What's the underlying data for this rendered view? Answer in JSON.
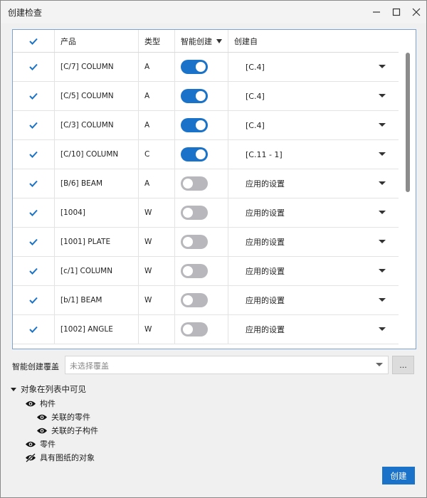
{
  "window": {
    "title": "创建检查"
  },
  "colors": {
    "accent": "#1a73c8",
    "toggle_off": "#b8b8bc",
    "frame_border": "#7da2ce"
  },
  "table": {
    "headers": {
      "product": "产品",
      "type": "类型",
      "smart_create": "智能创建",
      "created_from": "创建自"
    },
    "rows": [
      {
        "product": "[C/7] COLUMN",
        "type": "A",
        "smart": true,
        "source": "[C.4]",
        "checked": true
      },
      {
        "product": "[C/5] COLUMN",
        "type": "A",
        "smart": true,
        "source": "[C.4]",
        "checked": true
      },
      {
        "product": "[C/3] COLUMN",
        "type": "A",
        "smart": true,
        "source": "[C.4]",
        "checked": true
      },
      {
        "product": "[C/10] COLUMN",
        "type": "C",
        "smart": true,
        "source": "[C.11 - 1]",
        "checked": true
      },
      {
        "product": "[B/6] BEAM",
        "type": "A",
        "smart": false,
        "source": "应用的设置",
        "checked": true
      },
      {
        "product": "[1004]",
        "type": "W",
        "smart": false,
        "source": "应用的设置",
        "checked": true
      },
      {
        "product": "[1001] PLATE",
        "type": "W",
        "smart": false,
        "source": "应用的设置",
        "checked": true
      },
      {
        "product": "[c/1] COLUMN",
        "type": "W",
        "smart": false,
        "source": "应用的设置",
        "checked": true
      },
      {
        "product": "[b/1] BEAM",
        "type": "W",
        "smart": false,
        "source": "应用的设置",
        "checked": true
      },
      {
        "product": "[1002] ANGLE",
        "type": "W",
        "smart": false,
        "source": "应用的设置",
        "checked": true
      }
    ]
  },
  "override": {
    "label": "智能创建覆盖",
    "placeholder": "未选择覆盖",
    "browse_label": "..."
  },
  "visibility": {
    "heading": "对象在列表中可见",
    "items": [
      {
        "label": "构件",
        "icon": "eye-icon"
      },
      {
        "label": "关联的零件",
        "icon": "eye-icon"
      },
      {
        "label": "关联的子构件",
        "icon": "eye-icon"
      },
      {
        "label": "零件",
        "icon": "eye-icon"
      },
      {
        "label": "具有图纸的对象",
        "icon": "eye-off-icon"
      }
    ]
  },
  "actions": {
    "create_label": "创建"
  }
}
